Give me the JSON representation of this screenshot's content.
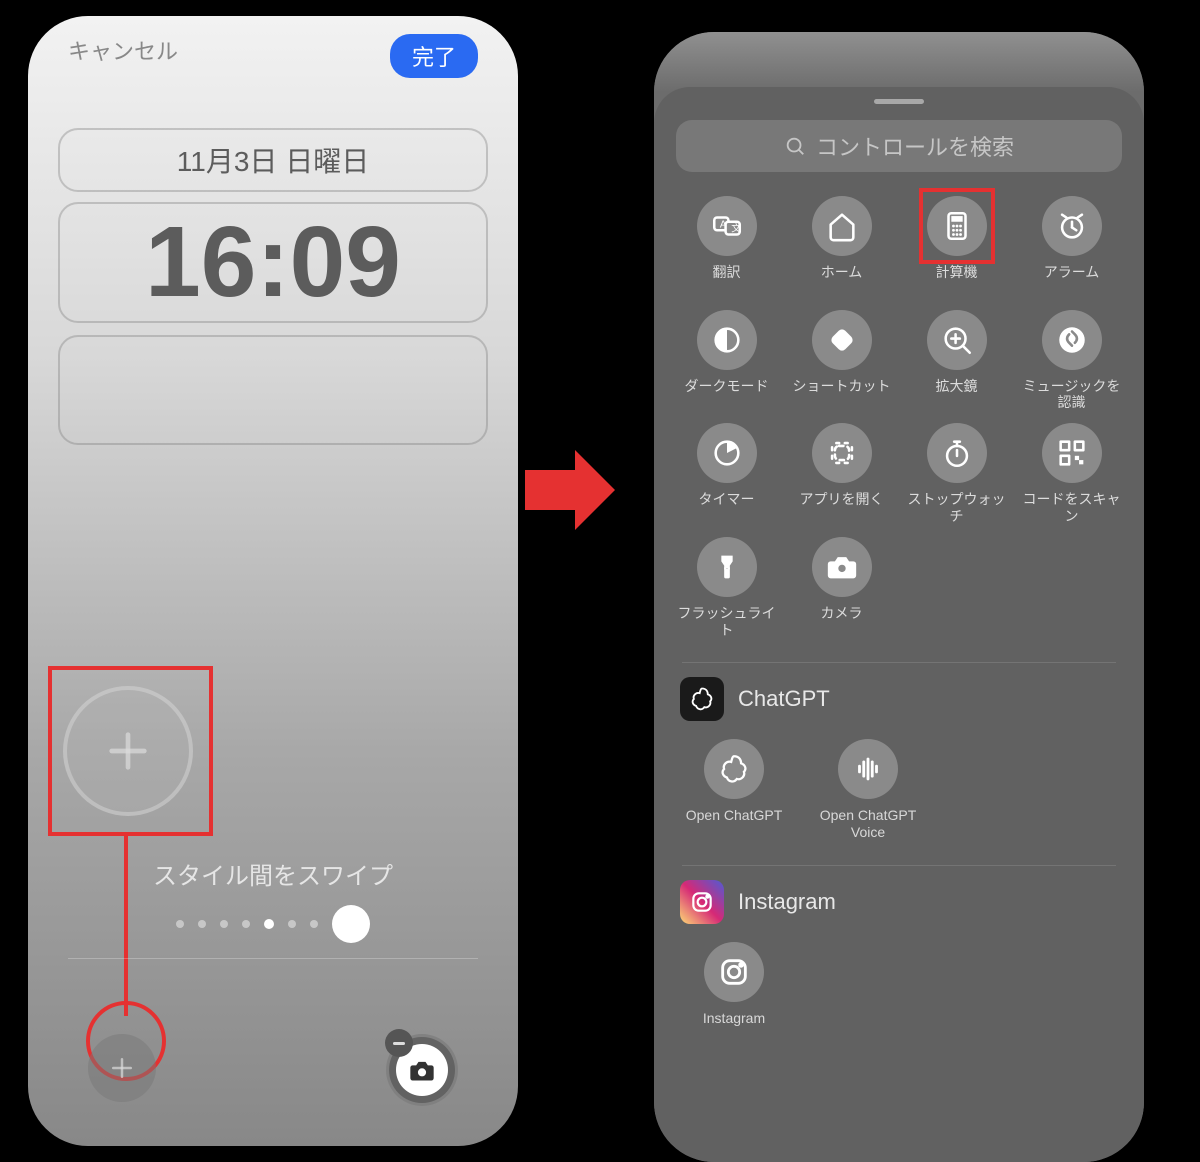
{
  "left": {
    "cancel": "キャンセル",
    "done": "完了",
    "date": "11月3日 日曜日",
    "time": "16:09",
    "swipe_label": "スタイル間をスワイプ"
  },
  "right": {
    "search_placeholder": "コントロールを検索",
    "controls": [
      {
        "id": "translate",
        "label": "翻訳",
        "icon": "translate"
      },
      {
        "id": "home",
        "label": "ホーム",
        "icon": "home"
      },
      {
        "id": "calculator",
        "label": "計算機",
        "icon": "calculator",
        "highlight": true
      },
      {
        "id": "alarm",
        "label": "アラーム",
        "icon": "alarm"
      },
      {
        "id": "darkmode",
        "label": "ダークモード",
        "icon": "darkmode"
      },
      {
        "id": "shortcuts",
        "label": "ショートカット",
        "icon": "shortcut"
      },
      {
        "id": "magnifier",
        "label": "拡大鏡",
        "icon": "magnifier"
      },
      {
        "id": "shazam",
        "label": "ミュージックを認識",
        "icon": "shazam"
      },
      {
        "id": "timer",
        "label": "タイマー",
        "icon": "timer"
      },
      {
        "id": "openapp",
        "label": "アプリを開く",
        "icon": "openapp"
      },
      {
        "id": "stopwatch",
        "label": "ストップウォッチ",
        "icon": "stopwatch"
      },
      {
        "id": "qrcode",
        "label": "コードをスキャン",
        "icon": "qr"
      },
      {
        "id": "flashlight",
        "label": "フラッシュライト",
        "icon": "flashlight"
      },
      {
        "id": "camera",
        "label": "カメラ",
        "icon": "camera"
      }
    ],
    "chatgpt": {
      "header": "ChatGPT",
      "items": [
        {
          "label": "Open ChatGPT",
          "icon": "chatgpt"
        },
        {
          "label": "Open ChatGPT Voice",
          "icon": "voice"
        }
      ]
    },
    "instagram": {
      "header": "Instagram",
      "items": [
        {
          "label": "Instagram",
          "icon": "instagram"
        }
      ]
    }
  }
}
